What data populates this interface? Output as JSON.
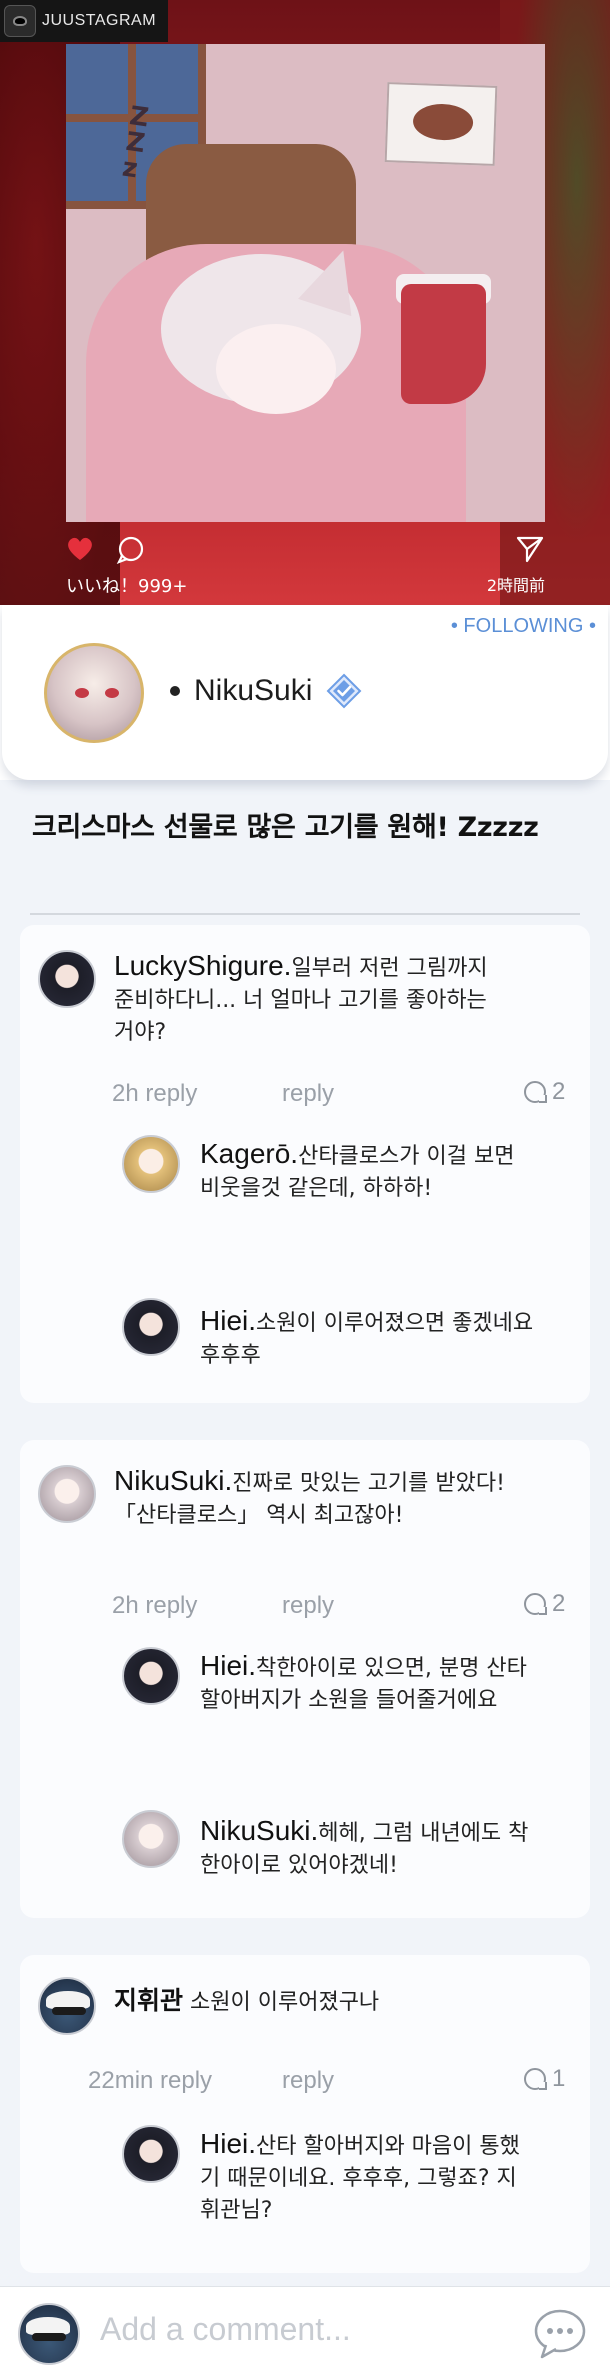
{
  "brand": {
    "name": "JUUSTAGRAM"
  },
  "post": {
    "likes": "いいね！999+",
    "time_ago": "2時間前",
    "caption": "크리스마스 선물로 많은 고기를 원해! Zzzzz"
  },
  "profile": {
    "following_label": "• FOLLOWING •",
    "username": "NikuSuki"
  },
  "comments": [
    {
      "author": "LuckyShigure.",
      "text_line1": "일부러 저런 그림까지",
      "text_line2": "준비하다니... 너 얼마나 고기를 좋아하는",
      "text_line3": "거야?",
      "time": "2h reply",
      "reply_label": "reply",
      "reply_count": "2",
      "replies": [
        {
          "author": "Kagerō.",
          "text_line1": "산타클로스가 이걸 보면",
          "text_line2": "비웃을것 같은데, 하하하!"
        },
        {
          "author": "Hiei.",
          "text_line1": "소원이 이루어졌으면 좋겠네요",
          "text_line2": "후후후"
        }
      ]
    },
    {
      "author": "NikuSuki.",
      "text_line1": "진짜로 맛있는 고기를 받았다!",
      "text_line2": "「산타클로스」 역시 최고잖아!",
      "time": "2h reply",
      "reply_label": "reply",
      "reply_count": "2",
      "replies": [
        {
          "author": "Hiei.",
          "text_line1": "착한아이로 있으면, 분명 산타",
          "text_line2": "할아버지가 소원을 들어줄거에요"
        },
        {
          "author": "NikuSuki.",
          "text_line1": "헤헤, 그럼 내년에도 착",
          "text_line2": "한아이로 있어야겠네!"
        }
      ]
    },
    {
      "author": "지휘관",
      "text_line1": "소원이 이루어졌구나",
      "time": "22min reply",
      "reply_label": "reply",
      "reply_count": "1",
      "replies": [
        {
          "author": "Hiei.",
          "text_line1": "산타 할아버지와 마음이 통했",
          "text_line2": "기 때문이네요. 후후후, 그렇죠? 지",
          "text_line3": "휘관님?"
        }
      ]
    }
  ],
  "composer": {
    "placeholder": "Add a comment..."
  },
  "colors": {
    "accent": "#5b8fd6",
    "like": "#e5303c",
    "feed_bg": "#f1f4f9"
  }
}
